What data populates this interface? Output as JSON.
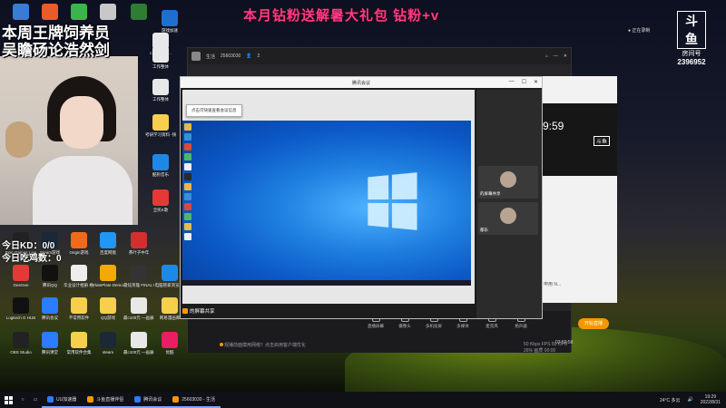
{
  "promo": "本月钻粉送解暑大礼包 钻粉+v",
  "streamer": {
    "line1": "本周王牌饲养员",
    "line2": "吴瞻砀论浩然剑",
    "today_kd": "今日KD：0/0",
    "today_chicken": "今日吃鸡数：0"
  },
  "douyu": {
    "logo": "斗鱼",
    "room_label": "房间号",
    "room_number": "2396952"
  },
  "recording": "正在录制",
  "desktop_icons": [
    {
      "label": "",
      "color": "#3a7bd5"
    },
    {
      "label": "",
      "color": "#e85c2a"
    },
    {
      "label": "",
      "color": "#3ab54a"
    },
    {
      "label": "",
      "color": "#c8c8c8"
    },
    {
      "label": "",
      "color": "#2e7d32"
    },
    {
      "label": "c100元\n一...",
      "color": "#e8e8e8"
    },
    {
      "label": "游戏加速",
      "color": "#1f6fd1"
    },
    {
      "label": "工作整体",
      "color": "#e8e8e8"
    },
    {
      "label": "工作整体",
      "color": "#e8e8e8"
    },
    {
      "label": "考研学习资料\n-快捷方式",
      "color": "#f6d04d"
    },
    {
      "label": "酷狗音乐",
      "color": "#1e88e5"
    },
    {
      "label": "全民K歌",
      "color": "#e53935"
    },
    {
      "label": "Epic Games\nLauncher",
      "color": "#222"
    },
    {
      "label": "Steam游戏",
      "color": "#1b2838"
    },
    {
      "label": "Origin游戏",
      "color": "#f06a1a"
    },
    {
      "label": "百度网盘",
      "color": "#2196f3"
    },
    {
      "label": "茶叶子中年",
      "color": "#d32f2f"
    },
    {
      "label": "GeeGee",
      "color": "#e53935"
    },
    {
      "label": "腾讯QQ",
      "color": "#111"
    },
    {
      "label": "华业设计相册\n格式",
      "color": "#eeeeee"
    },
    {
      "label": "FlatePlate\nDemo",
      "color": "#f2a900"
    },
    {
      "label": "最炫英雄\nFINAL BETA",
      "color": "#333"
    },
    {
      "label": "电脑管家浏览\n器",
      "color": "#1e88e5"
    },
    {
      "label": "Logitech G\nHUB",
      "color": "#111"
    },
    {
      "label": "腾讯会议",
      "color": "#2b7cff"
    },
    {
      "label": "不常用软件",
      "color": "#f6d04d"
    },
    {
      "label": "QQ游戏",
      "color": "#f6d04d"
    },
    {
      "label": "最c100元\n一画廊...",
      "color": "#e8e8e8"
    },
    {
      "label": "网易漫画库",
      "color": "#f6d04d"
    },
    {
      "label": "OBS Studio",
      "color": "#222"
    },
    {
      "label": "腾讯课堂",
      "color": "#2b7cff"
    },
    {
      "label": "常用软件合集",
      "color": "#f6d04d"
    },
    {
      "label": "steam",
      "color": "#1b2838"
    },
    {
      "label": "最c100元\n一画廊...",
      "color": "#e8e8e8"
    },
    {
      "label": "优酷",
      "color": "#e91e63"
    }
  ],
  "client": {
    "title": "生活",
    "room": "25603030",
    "viewers": "2",
    "bottom_buttons": [
      "直播屏幕",
      "摄像头",
      "多机投屏",
      "多媒体",
      "麦克风",
      "扬声器"
    ],
    "live_button": "开始直播",
    "tip": "观播前面摸用网络？点击启用客户端优化",
    "stats_text": "50 Kbps   FPS 50   CPU 26%   画质 00:00",
    "time": "03:59:58"
  },
  "right_panel": {
    "time": "9:59",
    "tag": "斗鱼",
    "line": "申用 N..."
  },
  "meeting": {
    "title": "腾讯会议",
    "notice": "点击可快速查看会议信息",
    "sharer": "的屏幕共享",
    "participants": [
      {
        "name": "的屏幕共享"
      },
      {
        "name": "都乐"
      }
    ]
  },
  "taskbar": {
    "items": [
      {
        "label": "UU加速器",
        "color": "#2b7cff"
      },
      {
        "label": "斗鱼直播伴侣",
        "color": "#f39800"
      },
      {
        "label": "腾讯会议",
        "color": "#2b7cff"
      },
      {
        "label": "25603030 - 生活",
        "color": "#f39800"
      }
    ],
    "weather": "24°C 多云",
    "time": "19:29",
    "date": "2022/8/31"
  }
}
